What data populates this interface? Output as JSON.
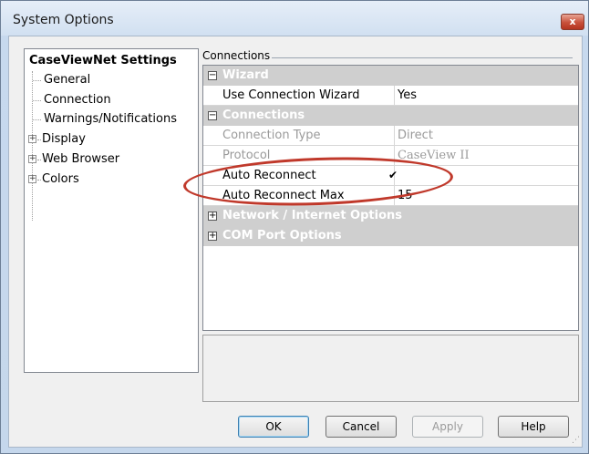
{
  "window": {
    "title": "System Options",
    "close_glyph": "x"
  },
  "tree": {
    "root": "CaseViewNet Settings",
    "items": [
      {
        "label": "General"
      },
      {
        "label": "Connection"
      },
      {
        "label": "Warnings/Notifications"
      },
      {
        "label": "Display",
        "expander": "+"
      },
      {
        "label": "Web Browser",
        "expander": "+"
      },
      {
        "label": "Colors",
        "expander": "+"
      }
    ]
  },
  "pane": {
    "header": "Connections"
  },
  "grid": {
    "wizard_category": {
      "label": "Wizard",
      "expander": "−"
    },
    "use_wizard": {
      "name": "Use Connection Wizard",
      "value": "Yes"
    },
    "connections_category": {
      "label": "Connections",
      "expander": "−"
    },
    "connection_type": {
      "name": "Connection Type",
      "value": "Direct"
    },
    "protocol": {
      "name": "Protocol",
      "value": "CaseView II"
    },
    "auto_reconnect": {
      "name": "Auto Reconnect",
      "value": "✔"
    },
    "auto_reconnect_max": {
      "name": "Auto Reconnect Max",
      "value": "15"
    },
    "network_category": {
      "label": "Network / Internet Options",
      "expander": "+"
    },
    "com_category": {
      "label": "COM Port Options",
      "expander": "+"
    }
  },
  "buttons": {
    "ok": "OK",
    "cancel": "Cancel",
    "apply": "Apply",
    "help": "Help"
  },
  "colors": {
    "highlight_oval": "#c0392b"
  }
}
